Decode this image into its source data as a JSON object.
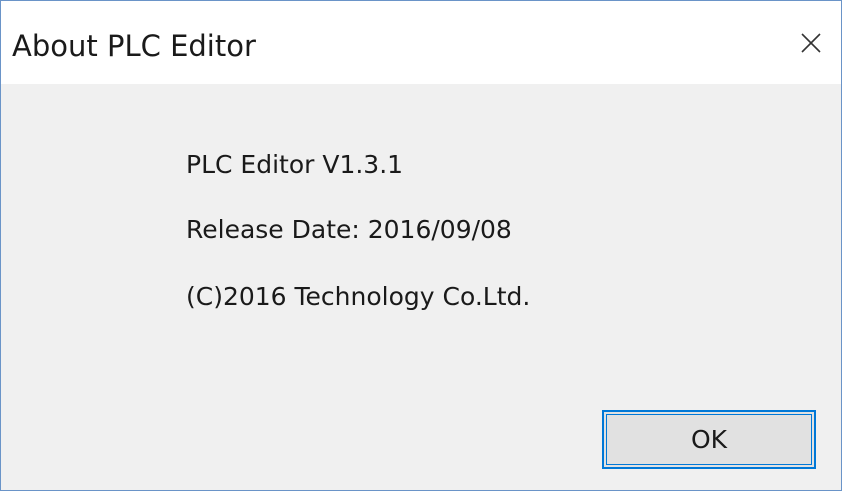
{
  "window": {
    "title": "About PLC Editor",
    "close_icon": "close-icon",
    "accent_color": "#0078d7",
    "border_color": "#6a94c8"
  },
  "about": {
    "version": "PLC Editor V1.3.1",
    "release_date": "Release Date: 2016/09/08",
    "copyright": "(C)2016 Technology Co.Ltd."
  },
  "buttons": {
    "ok_label": "OK"
  }
}
